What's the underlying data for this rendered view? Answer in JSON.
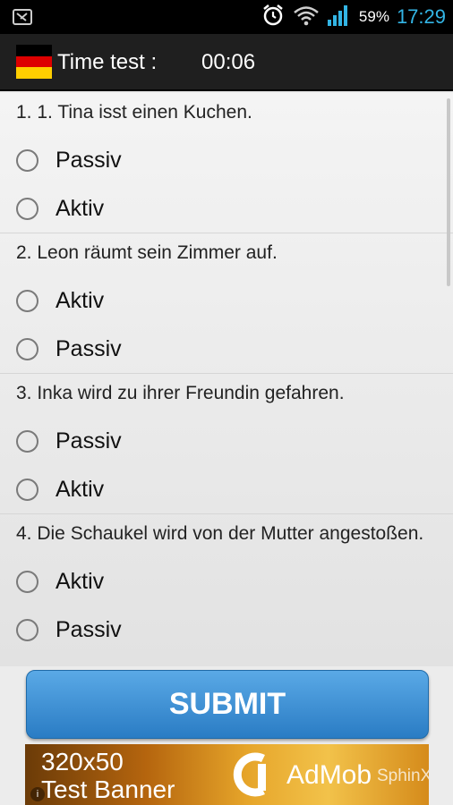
{
  "status_bar": {
    "battery_percent": "59%",
    "time": "17:29",
    "icons": [
      "notification-icon",
      "alarm-icon",
      "wifi-icon",
      "signal-icon",
      "battery-icon"
    ]
  },
  "app_bar": {
    "title": "Time test :",
    "timer": "00:06",
    "flag_icon": "germany-flag-icon",
    "flag_colors": [
      "#000000",
      "#dd0000",
      "#ffce00"
    ]
  },
  "questions": [
    {
      "text": "1. 1. Tina isst einen Kuchen.",
      "options": [
        "Passiv",
        "Aktiv"
      ]
    },
    {
      "text": "2. Leon räumt sein Zimmer auf.",
      "options": [
        "Aktiv",
        "Passiv"
      ]
    },
    {
      "text": "3. Inka wird zu ihrer Freundin gefahren.",
      "options": [
        "Passiv",
        "Aktiv"
      ]
    },
    {
      "text": "4. Die Schaukel wird von der Mutter angestoßen.",
      "options": [
        "Aktiv",
        "Passiv"
      ]
    }
  ],
  "submit_label": "SUBMIT",
  "ad": {
    "line1": "320x50",
    "line2": "Test Banner",
    "brand": "AdMob",
    "brand2": "SphinX",
    "info_icon": "info-icon"
  }
}
